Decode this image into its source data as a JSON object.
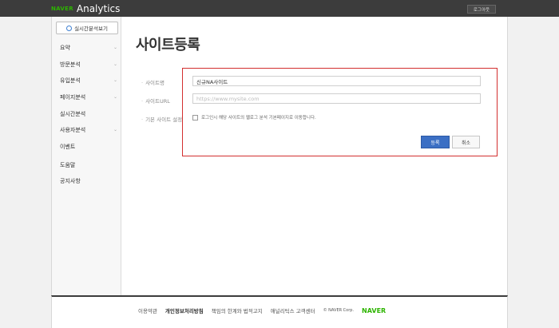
{
  "header": {
    "brand_naver": "NAVER",
    "brand_product": "Analytics",
    "login_label": "로그아웃"
  },
  "sidebar": {
    "realtime_button": "실시간분석보기",
    "items": [
      {
        "label": "요약",
        "has_chevron": true
      },
      {
        "label": "방문분석",
        "has_chevron": true
      },
      {
        "label": "유입분석",
        "has_chevron": true
      },
      {
        "label": "페이지분석",
        "has_chevron": true
      },
      {
        "label": "실시간분석",
        "has_chevron": false
      },
      {
        "label": "사용자분석",
        "has_chevron": true
      },
      {
        "label": "이벤트",
        "has_chevron": false
      },
      {
        "label": "도움말",
        "has_chevron": false
      },
      {
        "label": "공지사항",
        "has_chevron": false
      }
    ]
  },
  "main": {
    "page_title": "사이트등록",
    "form": {
      "site_name_label": "사이트명",
      "site_name_value": "신규NA사이트",
      "site_url_label": "사이트URL",
      "site_url_placeholder": "https://www.mysite.com",
      "default_site_label": "기본 사이트 설정",
      "default_site_checkbox_text": "로그인시 해당 사이트의 웹로그 분석 기본페이지로 이동합니다.",
      "default_site_checked": false
    },
    "buttons": {
      "register": "등록",
      "cancel": "취소"
    }
  },
  "footer": {
    "links": [
      "이용약관",
      "개인정보처리방침",
      "책임의 한계와 법적고지",
      "애널리틱스 고객센터"
    ],
    "copyright": "© NAVER Corp.",
    "logo": "NAVER"
  },
  "colors": {
    "brand_green": "#2db400",
    "primary_blue": "#3b6fc4",
    "highlight_red": "#d32f2f"
  }
}
